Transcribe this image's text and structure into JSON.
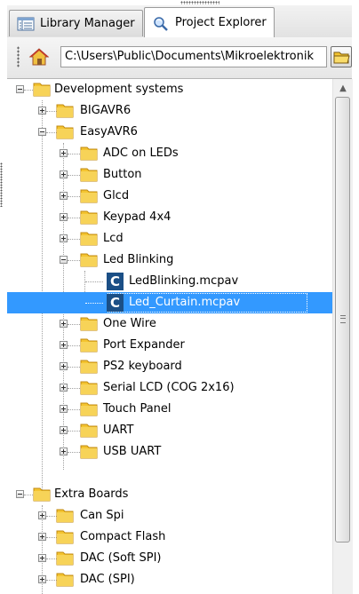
{
  "tabs": [
    {
      "label": "Library Manager",
      "icon": "library-icon",
      "active": false
    },
    {
      "label": "Project Explorer",
      "icon": "project-explorer-icon",
      "active": true
    }
  ],
  "toolbar": {
    "path": "C:\\Users\\Public\\Documents\\Mikroelektronik",
    "home_icon": "home-icon",
    "browse_icon": "folder-browse-icon"
  },
  "tree": {
    "items": [
      {
        "label": "Development systems",
        "type": "folder",
        "expanded": true
      },
      {
        "label": "BIGAVR6",
        "type": "folder",
        "expanded": false
      },
      {
        "label": "EasyAVR6",
        "type": "folder",
        "expanded": true
      },
      {
        "label": "ADC on LEDs",
        "type": "folder",
        "expanded": false
      },
      {
        "label": "Button",
        "type": "folder",
        "expanded": false
      },
      {
        "label": "Glcd",
        "type": "folder",
        "expanded": false
      },
      {
        "label": "Keypad 4x4",
        "type": "folder",
        "expanded": false
      },
      {
        "label": "Lcd",
        "type": "folder",
        "expanded": false
      },
      {
        "label": "Led Blinking",
        "type": "folder",
        "expanded": true
      },
      {
        "label": "LedBlinking.mcpav",
        "type": "project-file"
      },
      {
        "label": "Led_Curtain.mcpav",
        "type": "project-file",
        "selected": true
      },
      {
        "label": "One Wire",
        "type": "folder",
        "expanded": false
      },
      {
        "label": "Port Expander",
        "type": "folder",
        "expanded": false
      },
      {
        "label": "PS2 keyboard",
        "type": "folder",
        "expanded": false
      },
      {
        "label": "Serial LCD (COG 2x16)",
        "type": "folder",
        "expanded": false
      },
      {
        "label": "Touch Panel",
        "type": "folder",
        "expanded": false
      },
      {
        "label": "UART",
        "type": "folder",
        "expanded": false
      },
      {
        "label": "USB UART",
        "type": "folder",
        "expanded": false
      },
      {
        "label": "Extra Boards",
        "type": "folder",
        "expanded": true
      },
      {
        "label": "Can Spi",
        "type": "folder",
        "expanded": false
      },
      {
        "label": "Compact Flash",
        "type": "folder",
        "expanded": false
      },
      {
        "label": "DAC (Soft SPI)",
        "type": "folder",
        "expanded": false
      },
      {
        "label": "DAC (SPI)",
        "type": "folder",
        "expanded": false
      }
    ]
  },
  "colors": {
    "selection": "#3399ff",
    "folder": "#f4c430",
    "project_file_icon": "#1b4f86"
  }
}
